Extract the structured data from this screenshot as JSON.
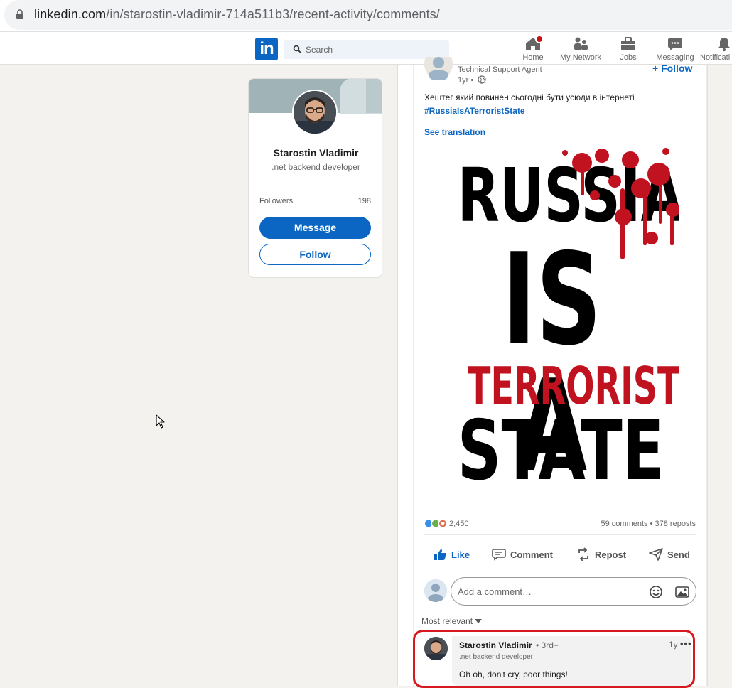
{
  "browser": {
    "url_host": "linkedin.com",
    "url_path": "/in/starostin-vladimir-714a511b3/recent-activity/comments/"
  },
  "navbar": {
    "logo_text": "in",
    "search_placeholder": "Search",
    "items": [
      {
        "label": "Home",
        "icon": "home-icon"
      },
      {
        "label": "My Network",
        "icon": "network-icon"
      },
      {
        "label": "Jobs",
        "icon": "briefcase-icon"
      },
      {
        "label": "Messaging",
        "icon": "messaging-icon"
      },
      {
        "label": "Notificati",
        "icon": "bell-icon"
      }
    ]
  },
  "profile_card": {
    "name": "Starostin Vladimir",
    "headline": ".net backend developer",
    "followers_label": "Followers",
    "followers_count": "198",
    "message_button": "Message",
    "follow_button": "Follow"
  },
  "post": {
    "author_subtitle": "Technical Support Agent",
    "time": "1yr •",
    "follow_label": "+ Follow",
    "text": "Хештег який повинен сьогодні бути усюди в інтернеті",
    "hashtag": "#RussiaIsATerroristState",
    "see_translation": "See translation",
    "image_lines": [
      "RUSSIA",
      "IS A",
      "TERRORIST",
      "STATE"
    ],
    "reaction_count": "2,450",
    "comments_reposts": "59 comments • 378 reposts",
    "actions": {
      "like": "Like",
      "comment": "Comment",
      "repost": "Repost",
      "send": "Send"
    },
    "comment_placeholder": "Add a comment…",
    "sort_label": "Most relevant"
  },
  "comment": {
    "author": "Starostin Vladimir",
    "degree": "• 3rd+",
    "headline": ".net backend developer",
    "time": "1y",
    "text": "Oh oh, don't cry, poor things!"
  },
  "colors": {
    "brand_blue": "#0a66c2",
    "highlight_red": "#d7191f",
    "poster_red": "#c1121f"
  }
}
